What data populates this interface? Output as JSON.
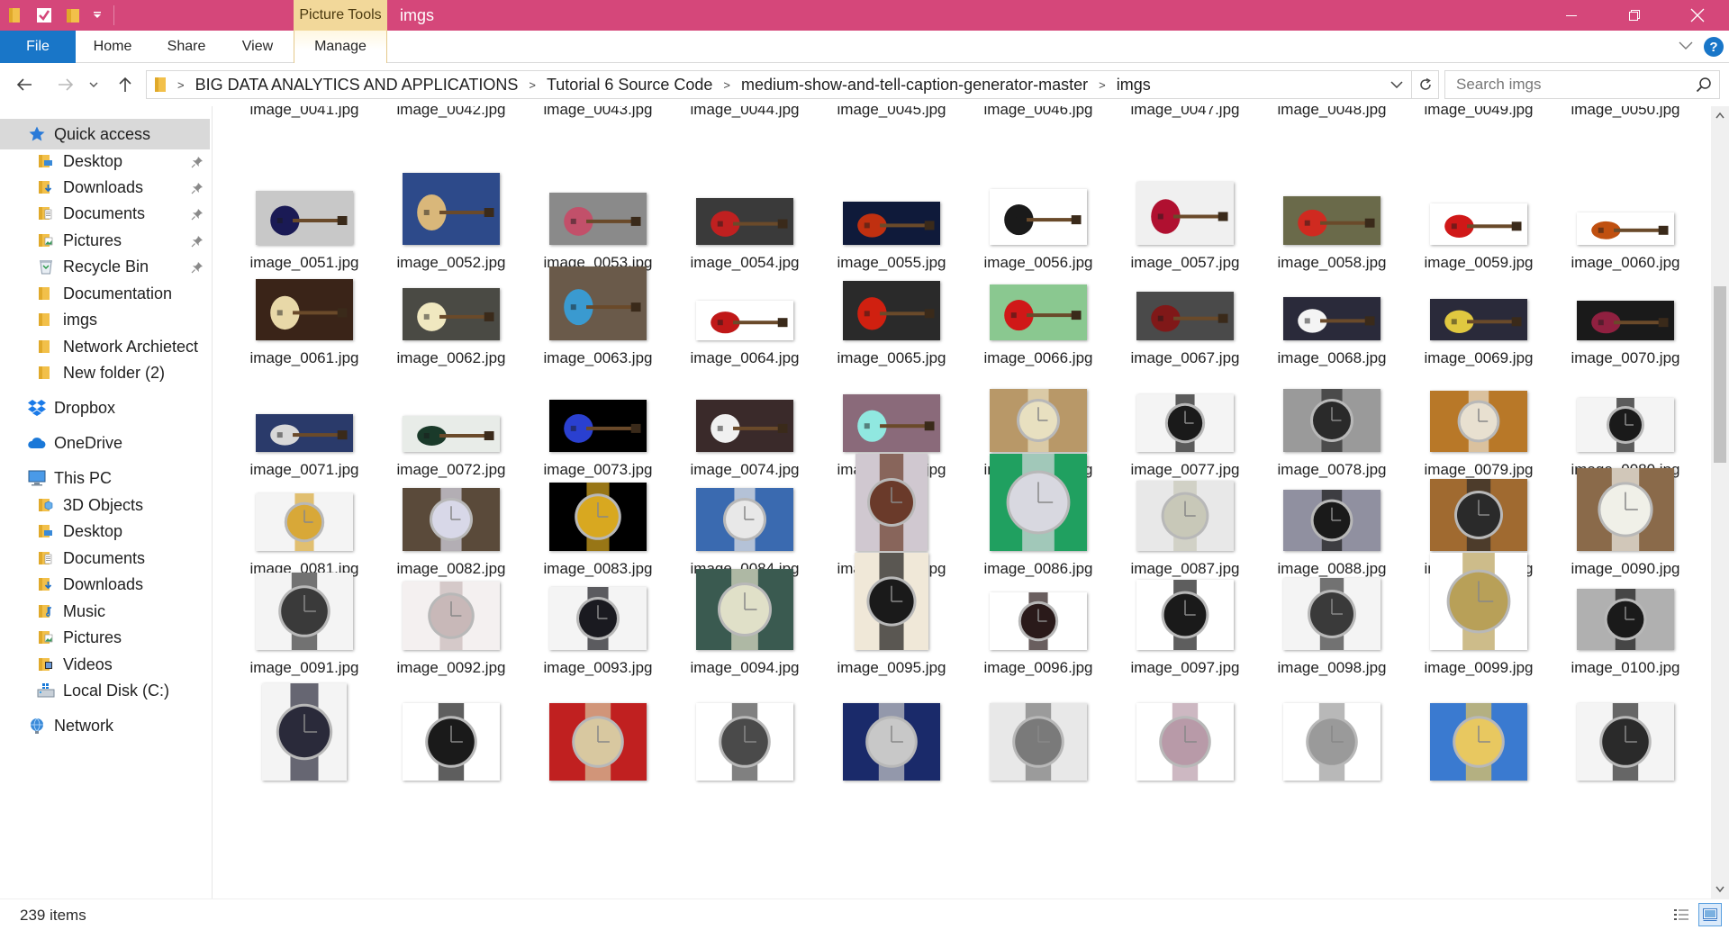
{
  "window": {
    "title": "imgs",
    "context_tab_group": "Picture Tools",
    "accent_color": "#d5477a"
  },
  "ribbon": {
    "tabs": [
      "File",
      "Home",
      "Share",
      "View",
      "Manage"
    ]
  },
  "address": {
    "breadcrumbs": [
      "BIG DATA ANALYTICS AND APPLICATIONS",
      "Tutorial 6 Source Code",
      "medium-show-and-tell-caption-generator-master",
      "imgs"
    ]
  },
  "search": {
    "placeholder": "Search imgs"
  },
  "sidebar": {
    "items": [
      {
        "label": "Quick access",
        "icon": "star-icon",
        "pinned": false,
        "selected": true,
        "level": 0
      },
      {
        "label": "Desktop",
        "icon": "desktop-folder-icon",
        "pinned": true,
        "level": 1
      },
      {
        "label": "Downloads",
        "icon": "downloads-folder-icon",
        "pinned": true,
        "level": 1
      },
      {
        "label": "Documents",
        "icon": "documents-folder-icon",
        "pinned": true,
        "level": 1
      },
      {
        "label": "Pictures",
        "icon": "pictures-folder-icon",
        "pinned": true,
        "level": 1
      },
      {
        "label": "Recycle Bin",
        "icon": "recycle-bin-icon",
        "pinned": true,
        "level": 1
      },
      {
        "label": "Documentation",
        "icon": "folder-icon",
        "pinned": false,
        "level": 1
      },
      {
        "label": "imgs",
        "icon": "folder-icon",
        "pinned": false,
        "level": 1
      },
      {
        "label": "Network Archietectu",
        "icon": "folder-icon",
        "pinned": false,
        "level": 1
      },
      {
        "label": "New folder (2)",
        "icon": "folder-icon",
        "pinned": false,
        "level": 1
      },
      {
        "label": "Dropbox",
        "icon": "dropbox-icon",
        "pinned": false,
        "level": 0
      },
      {
        "label": "OneDrive",
        "icon": "onedrive-icon",
        "pinned": false,
        "level": 0
      },
      {
        "label": "This PC",
        "icon": "computer-icon",
        "pinned": false,
        "level": 0
      },
      {
        "label": "3D Objects",
        "icon": "3d-objects-folder-icon",
        "pinned": false,
        "level": 1
      },
      {
        "label": "Desktop",
        "icon": "desktop-folder-icon",
        "pinned": false,
        "level": 1
      },
      {
        "label": "Documents",
        "icon": "documents-folder-icon",
        "pinned": false,
        "level": 1
      },
      {
        "label": "Downloads",
        "icon": "downloads-folder-icon",
        "pinned": false,
        "level": 1
      },
      {
        "label": "Music",
        "icon": "music-folder-icon",
        "pinned": false,
        "level": 1
      },
      {
        "label": "Pictures",
        "icon": "pictures-folder-icon",
        "pinned": false,
        "level": 1
      },
      {
        "label": "Videos",
        "icon": "videos-folder-icon",
        "pinned": false,
        "level": 1
      },
      {
        "label": "Local Disk (C:)",
        "icon": "drive-icon",
        "pinned": false,
        "level": 1
      },
      {
        "label": "Network",
        "icon": "network-icon",
        "pinned": false,
        "level": 0
      }
    ]
  },
  "files": {
    "partial_top_row": [
      "image_0041.jpg",
      "image_0042.jpg",
      "image_0043.jpg",
      "image_0044.jpg",
      "image_0045.jpg",
      "image_0046.jpg",
      "image_0047.jpg",
      "image_0048.jpg",
      "image_0049.jpg",
      "image_0050.jpg"
    ],
    "rows": [
      [
        {
          "name": "image_0051.jpg",
          "bg": "#c8c8c8",
          "fg": "#1a1a55",
          "kind": "guitar"
        },
        {
          "name": "image_0052.jpg",
          "bg": "#2d4a8a",
          "fg": "#d9b77a",
          "kind": "guitar"
        },
        {
          "name": "image_0053.jpg",
          "bg": "#8a8a8a",
          "fg": "#c2506a",
          "kind": "guitar"
        },
        {
          "name": "image_0054.jpg",
          "bg": "#3a3a3a",
          "fg": "#c02020",
          "kind": "guitar"
        },
        {
          "name": "image_0055.jpg",
          "bg": "#0f1a3a",
          "fg": "#c03010",
          "kind": "guitar"
        },
        {
          "name": "image_0056.jpg",
          "bg": "#ffffff",
          "fg": "#1a1a1a",
          "kind": "guitar"
        },
        {
          "name": "image_0057.jpg",
          "bg": "#f0f0f0",
          "fg": "#b01030",
          "kind": "guitar"
        },
        {
          "name": "image_0058.jpg",
          "bg": "#6a6a4a",
          "fg": "#d02a20",
          "kind": "guitar"
        },
        {
          "name": "image_0059.jpg",
          "bg": "#ffffff",
          "fg": "#d01818",
          "kind": "guitar"
        },
        {
          "name": "image_0060.jpg",
          "bg": "#ffffff",
          "fg": "#c05010",
          "kind": "guitar"
        }
      ],
      [
        {
          "name": "image_0061.jpg",
          "bg": "#3a2418",
          "fg": "#e8d8a8",
          "kind": "guitar"
        },
        {
          "name": "image_0062.jpg",
          "bg": "#4a4a44",
          "fg": "#f0e8c0",
          "kind": "guitar"
        },
        {
          "name": "image_0063.jpg",
          "bg": "#6a5a4a",
          "fg": "#3a9ad0",
          "kind": "guitar"
        },
        {
          "name": "image_0064.jpg",
          "bg": "#ffffff",
          "fg": "#c01818",
          "kind": "guitar"
        },
        {
          "name": "image_0065.jpg",
          "bg": "#2a2a2a",
          "fg": "#d02010",
          "kind": "guitar"
        },
        {
          "name": "image_0066.jpg",
          "bg": "#8ac890",
          "fg": "#d01818",
          "kind": "guitar"
        },
        {
          "name": "image_0067.jpg",
          "bg": "#4a4a4a",
          "fg": "#801818",
          "kind": "guitar"
        },
        {
          "name": "image_0068.jpg",
          "bg": "#2a2a3a",
          "fg": "#f4f4f4",
          "kind": "guitar"
        },
        {
          "name": "image_0069.jpg",
          "bg": "#2a2a3a",
          "fg": "#e0c840",
          "kind": "guitar"
        },
        {
          "name": "image_0070.jpg",
          "bg": "#1a1a1a",
          "fg": "#902040",
          "kind": "guitar"
        }
      ],
      [
        {
          "name": "image_0071.jpg",
          "bg": "#2a3a6a",
          "fg": "#d8d8d8",
          "kind": "guitar"
        },
        {
          "name": "image_0072.jpg",
          "bg": "#e8ece8",
          "fg": "#1a3a2a",
          "kind": "guitar"
        },
        {
          "name": "image_0073.jpg",
          "bg": "#000000",
          "fg": "#2a40d0",
          "kind": "guitar"
        },
        {
          "name": "image_0074.jpg",
          "bg": "#3a2a2a",
          "fg": "#f0f0f0",
          "kind": "guitar"
        },
        {
          "name": "image_0075.jpg",
          "bg": "#8a6a7a",
          "fg": "#90e8e0",
          "kind": "guitar"
        },
        {
          "name": "image_0076.jpg",
          "bg": "#b89868",
          "fg": "#e8e0c0",
          "kind": "watch"
        },
        {
          "name": "image_0077.jpg",
          "bg": "#f4f4f4",
          "fg": "#1a1a1a",
          "kind": "watch"
        },
        {
          "name": "image_0078.jpg",
          "bg": "#9a9a9a",
          "fg": "#2a2a2a",
          "kind": "watch"
        },
        {
          "name": "image_0079.jpg",
          "bg": "#b87828",
          "fg": "#e8e0d0",
          "kind": "watch"
        },
        {
          "name": "image_0080.jpg",
          "bg": "#f4f4f4",
          "fg": "#1a1a1a",
          "kind": "watch"
        }
      ],
      [
        {
          "name": "image_0081.jpg",
          "bg": "#f4f4f4",
          "fg": "#d8a838",
          "kind": "watch"
        },
        {
          "name": "image_0082.jpg",
          "bg": "#5a4a3a",
          "fg": "#d8d8e8",
          "kind": "watch"
        },
        {
          "name": "image_0083.jpg",
          "bg": "#000000",
          "fg": "#d8a820",
          "kind": "watch"
        },
        {
          "name": "image_0084.jpg",
          "bg": "#3a6ab0",
          "fg": "#e8e8e8",
          "kind": "watch"
        },
        {
          "name": "image_0085.jpg",
          "bg": "#d0c8d0",
          "fg": "#6a3a2a",
          "kind": "watch"
        },
        {
          "name": "image_0086.jpg",
          "bg": "#20a060",
          "fg": "#d8d8e0",
          "kind": "watch"
        },
        {
          "name": "image_0087.jpg",
          "bg": "#e8e8e8",
          "fg": "#c8c8b8",
          "kind": "watch"
        },
        {
          "name": "image_0088.jpg",
          "bg": "#9090a0",
          "fg": "#1a1a1a",
          "kind": "watch"
        },
        {
          "name": "image_0089.jpg",
          "bg": "#a06a30",
          "fg": "#2a2a2a",
          "kind": "watch"
        },
        {
          "name": "image_0090.jpg",
          "bg": "#8a6a4a",
          "fg": "#f0f0e8",
          "kind": "watch"
        }
      ],
      [
        {
          "name": "image_0091.jpg",
          "bg": "#f4f4f4",
          "fg": "#3a3a3a",
          "kind": "watch"
        },
        {
          "name": "image_0092.jpg",
          "bg": "#f4f0f0",
          "fg": "#c8b8b8",
          "kind": "watch"
        },
        {
          "name": "image_0093.jpg",
          "bg": "#f4f4f4",
          "fg": "#1a1a20",
          "kind": "watch"
        },
        {
          "name": "image_0094.jpg",
          "bg": "#3a5a50",
          "fg": "#e0e0c8",
          "kind": "watch"
        },
        {
          "name": "image_0095.jpg",
          "bg": "#f0e8d8",
          "fg": "#1a1a1a",
          "kind": "watch"
        },
        {
          "name": "image_0096.jpg",
          "bg": "#ffffff",
          "fg": "#2a1a1a",
          "kind": "watch"
        },
        {
          "name": "image_0097.jpg",
          "bg": "#ffffff",
          "fg": "#1a1a1a",
          "kind": "watch"
        },
        {
          "name": "image_0098.jpg",
          "bg": "#f4f4f4",
          "fg": "#3a3a3a",
          "kind": "watch"
        },
        {
          "name": "image_0099.jpg",
          "bg": "#ffffff",
          "fg": "#b8a058",
          "kind": "watch"
        },
        {
          "name": "image_0100.jpg",
          "bg": "#b0b0b0",
          "fg": "#1a1a1a",
          "kind": "watch"
        }
      ],
      [
        {
          "name": "",
          "bg": "#f4f4f4",
          "fg": "#2a2a3a",
          "kind": "watch"
        },
        {
          "name": "",
          "bg": "#ffffff",
          "fg": "#1a1a1a",
          "kind": "watch"
        },
        {
          "name": "",
          "bg": "#c02020",
          "fg": "#d8c8a0",
          "kind": "watch"
        },
        {
          "name": "",
          "bg": "#ffffff",
          "fg": "#4a4a4a",
          "kind": "watch"
        },
        {
          "name": "",
          "bg": "#1a2a6a",
          "fg": "#c8c8c8",
          "kind": "watch"
        },
        {
          "name": "",
          "bg": "#e8e8e8",
          "fg": "#7a7a7a",
          "kind": "watch"
        },
        {
          "name": "",
          "bg": "#ffffff",
          "fg": "#b89aa8",
          "kind": "watch"
        },
        {
          "name": "",
          "bg": "#ffffff",
          "fg": "#9a9a9a",
          "kind": "watch"
        },
        {
          "name": "",
          "bg": "#3a7ad0",
          "fg": "#e8c860",
          "kind": "watch"
        },
        {
          "name": "",
          "bg": "#f4f4f4",
          "fg": "#2a2a2a",
          "kind": "watch"
        }
      ]
    ]
  },
  "status": {
    "item_count": "239 items"
  }
}
